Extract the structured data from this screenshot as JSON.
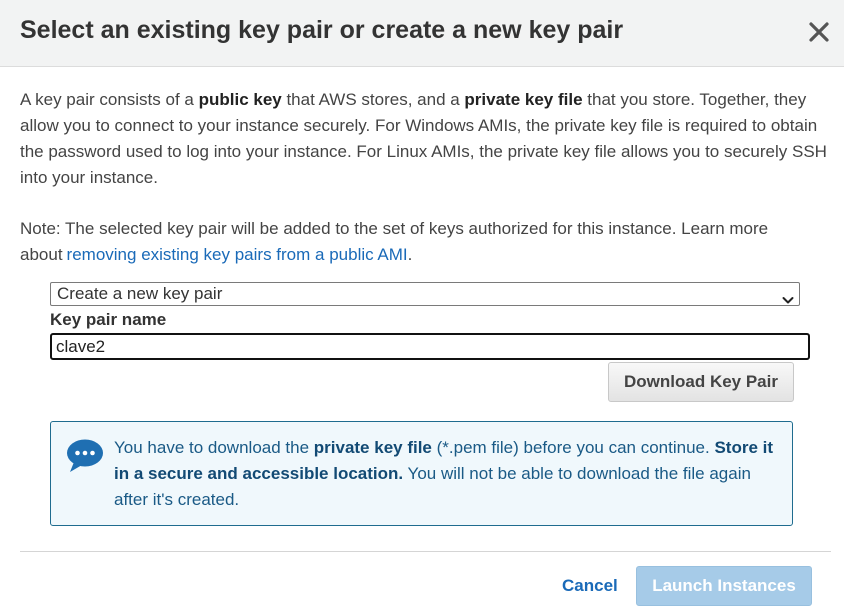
{
  "dialog": {
    "title": "Select an existing key pair or create a new key pair",
    "close_icon": "close-icon"
  },
  "intro": {
    "t1": "A key pair consists of a ",
    "b1": "public key",
    "t2": " that AWS stores, and a ",
    "b2": "private key file",
    "t3": " that you store. Together, they allow you to connect to your instance securely. For Windows AMIs, the private key file is required to obtain the password used to log into your instance. For Linux AMIs, the private key file allows you to securely SSH into your instance."
  },
  "note": {
    "text": "Note: The selected key pair will be added to the set of keys authorized for this instance. Learn more about",
    "link": "removing existing key pairs from a public AMI",
    "end": "."
  },
  "key_pair_select": {
    "selected": "Create a new key pair",
    "icon": "chevron-down-icon"
  },
  "key_pair_name": {
    "label": "Key pair name",
    "value": "clave2"
  },
  "download_button": "Download Key Pair",
  "info": {
    "icon": "speech-bubble-icon",
    "t1": "You have to download the ",
    "b1": "private key file",
    "t2": " (*.pem file) before you can continue. ",
    "b2": "Store it in a secure and accessible location.",
    "t3": " You will not be able to download the file again after it's created."
  },
  "footer": {
    "cancel": "Cancel",
    "launch": "Launch Instances"
  },
  "colors": {
    "link": "#1a6ab8",
    "info_border": "#1f6c8f",
    "info_background": "#f0f8fc",
    "launch_disabled": "#a6cbe8"
  }
}
